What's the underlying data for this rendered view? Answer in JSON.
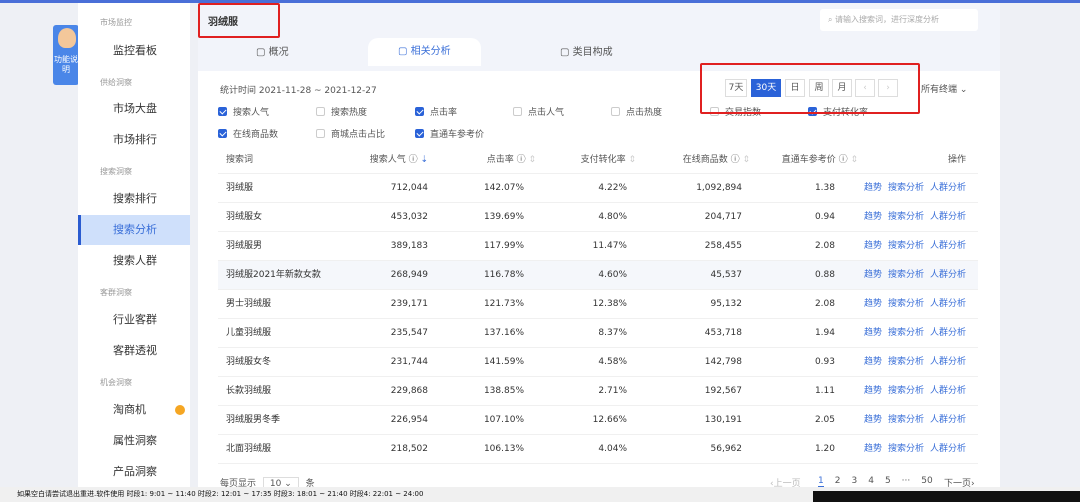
{
  "badge": {
    "label": "功能说明"
  },
  "sidebar": {
    "groups": [
      {
        "title": "市场监控",
        "items": [
          "监控看板"
        ]
      },
      {
        "title": "供给洞察",
        "items": [
          "市场大盘",
          "市场排行"
        ]
      },
      {
        "title": "搜索洞察",
        "items": [
          "搜索排行",
          "搜索分析",
          "搜索人群"
        ]
      },
      {
        "title": "客群洞察",
        "items": [
          "行业客群",
          "客群透视"
        ]
      },
      {
        "title": "机会洞察",
        "items": [
          "淘商机",
          "属性洞察",
          "产品洞察"
        ]
      }
    ],
    "active": "搜索分析"
  },
  "header": {
    "title": "羽绒服",
    "search_placeholder": "请输入搜索词，进行深度分析",
    "tabs": [
      "概况",
      "相关分析",
      "类目构成"
    ],
    "active_tab": "相关分析"
  },
  "filters": {
    "stat_time": "统计时间 2021-11-28 ~ 2021-12-27",
    "periods": [
      "7天",
      "30天",
      "日",
      "周",
      "月"
    ],
    "active_period": "30天",
    "prev": "‹",
    "next": "›",
    "terminal": "所有终端"
  },
  "checkboxes": [
    {
      "label": "搜索人气",
      "checked": true
    },
    {
      "label": "搜索热度",
      "checked": false
    },
    {
      "label": "点击率",
      "checked": true
    },
    {
      "label": "点击人气",
      "checked": false
    },
    {
      "label": "点击热度",
      "checked": false
    },
    {
      "label": "交易指数",
      "checked": false
    },
    {
      "label": "支付转化率",
      "checked": true
    },
    {
      "label": "在线商品数",
      "checked": true
    },
    {
      "label": "商城点击占比",
      "checked": false
    },
    {
      "label": "直通车参考价",
      "checked": true
    }
  ],
  "table": {
    "headers": [
      "搜索词",
      "搜索人气 ⓘ",
      "点击率 ⓘ",
      "支付转化率",
      "在线商品数 ⓘ",
      "直通车参考价 ⓘ",
      "操作"
    ],
    "ops": [
      "趋势",
      "搜索分析",
      "人群分析"
    ],
    "rows": [
      [
        "羽绒服",
        "712,044",
        "142.07%",
        "4.22%",
        "1,092,894",
        "1.38"
      ],
      [
        "羽绒服女",
        "453,032",
        "139.69%",
        "4.80%",
        "204,717",
        "0.94"
      ],
      [
        "羽绒服男",
        "389,183",
        "117.99%",
        "11.47%",
        "258,455",
        "2.08"
      ],
      [
        "羽绒服2021年新款女款",
        "268,949",
        "116.78%",
        "4.60%",
        "45,537",
        "0.88"
      ],
      [
        "男士羽绒服",
        "239,171",
        "121.73%",
        "12.38%",
        "95,132",
        "2.08"
      ],
      [
        "儿童羽绒服",
        "235,547",
        "137.16%",
        "8.37%",
        "453,718",
        "1.94"
      ],
      [
        "羽绒服女冬",
        "231,744",
        "141.59%",
        "4.58%",
        "142,798",
        "0.93"
      ],
      [
        "长款羽绒服",
        "229,868",
        "138.85%",
        "2.71%",
        "192,567",
        "1.11"
      ],
      [
        "羽绒服男冬季",
        "226,954",
        "107.10%",
        "12.66%",
        "130,191",
        "2.05"
      ],
      [
        "北面羽绒服",
        "218,502",
        "106.13%",
        "4.04%",
        "56,962",
        "1.20"
      ]
    ]
  },
  "pagination": {
    "per_page_label": "每页显示",
    "per_page": "10",
    "unit": "条",
    "prev": "‹上一页",
    "pages": [
      "1",
      "2",
      "3",
      "4",
      "5",
      "···",
      "50"
    ],
    "current": "1",
    "next": "下一页›"
  },
  "status_bar": "如果空白请尝试退出重进.软件使用 时段1: 9:01 ~ 11:40  时段2: 12:01 ~ 17:35  时段3: 18:01 ~ 21:40  时段4: 22:01 ~ 24:00"
}
